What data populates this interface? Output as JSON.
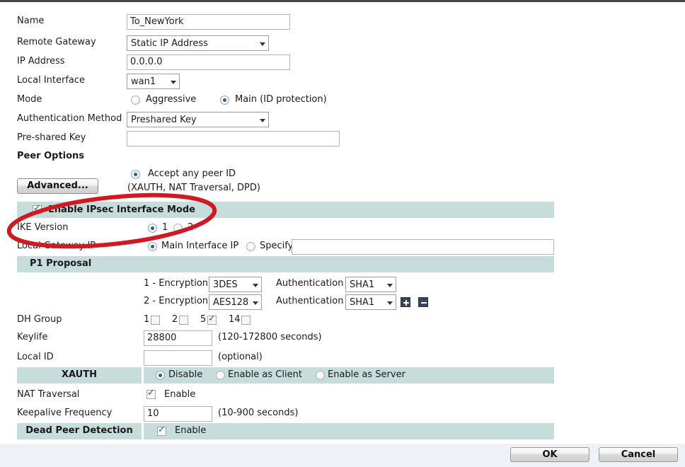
{
  "form": {
    "fields": {
      "name": {
        "label": "Name",
        "value": "To_NewYork"
      },
      "remote_gateway": {
        "label": "Remote Gateway",
        "value": "Static IP Address"
      },
      "ip_address": {
        "label": "IP Address",
        "value": "0.0.0.0"
      },
      "local_interface": {
        "label": "Local Interface",
        "value": "wan1"
      },
      "mode": {
        "label": "Mode",
        "option_aggressive": "Aggressive",
        "option_main": "Main (ID protection)",
        "selected": "Main (ID protection)"
      },
      "auth_method": {
        "label": "Authentication Method",
        "value": "Preshared Key"
      },
      "preshared_key": {
        "label": "Pre-shared Key",
        "value": ""
      }
    },
    "peer_options": {
      "title": "Peer Options",
      "accept_any_peer_id": "Accept any peer ID",
      "advanced_button": "Advanced...",
      "advanced_note": "(XAUTH, NAT Traversal, DPD)"
    },
    "ipsec_interface_mode": {
      "label": "Enable IPsec Interface Mode",
      "checked": true
    },
    "ike_version": {
      "label": "IKE Version",
      "option_1": "1",
      "option_2": "2",
      "selected": "1"
    },
    "local_gateway_ip": {
      "label": "Local Gateway IP",
      "option_main": "Main Interface IP",
      "option_specify": "Specify",
      "selected": "Main Interface IP",
      "specify_value": ""
    },
    "p1_proposal": {
      "title": "P1 Proposal",
      "rows": [
        {
          "index": "1 - Encryption",
          "encryption": "3DES",
          "auth_label": "Authentication",
          "auth": "SHA1"
        },
        {
          "index": "2 - Encryption",
          "encryption": "AES128",
          "auth_label": "Authentication",
          "auth": "SHA1"
        }
      ],
      "add_icon": "plus-icon",
      "remove_icon": "minus-icon"
    },
    "dh_group": {
      "label": "DH Group",
      "options": [
        {
          "label": "1",
          "checked": false
        },
        {
          "label": "2",
          "checked": false
        },
        {
          "label": "5",
          "checked": true
        },
        {
          "label": "14",
          "checked": false
        }
      ]
    },
    "keylife": {
      "label": "Keylife",
      "value": "28800",
      "hint": "(120-172800 seconds)"
    },
    "local_id": {
      "label": "Local ID",
      "value": "",
      "hint": "(optional)"
    },
    "xauth": {
      "title": "XAUTH",
      "option_disable": "Disable",
      "option_client": "Enable as Client",
      "option_server": "Enable as Server",
      "selected": "Disable"
    },
    "nat_traversal": {
      "label": "NAT Traversal",
      "enable_label": "Enable",
      "checked": true
    },
    "keepalive": {
      "label": "Keepalive Frequency",
      "value": "10",
      "hint": "(10-900 seconds)"
    },
    "dead_peer_detection": {
      "title": "Dead Peer Detection",
      "enable_label": "Enable",
      "checked": true
    }
  },
  "footer": {
    "ok": "OK",
    "cancel": "Cancel"
  },
  "colors": {
    "section_band": "#c7dddc",
    "annotation": "#cc1b22",
    "radio_dot": "#2b5f8f",
    "footer_bg": "#eef1f6"
  }
}
